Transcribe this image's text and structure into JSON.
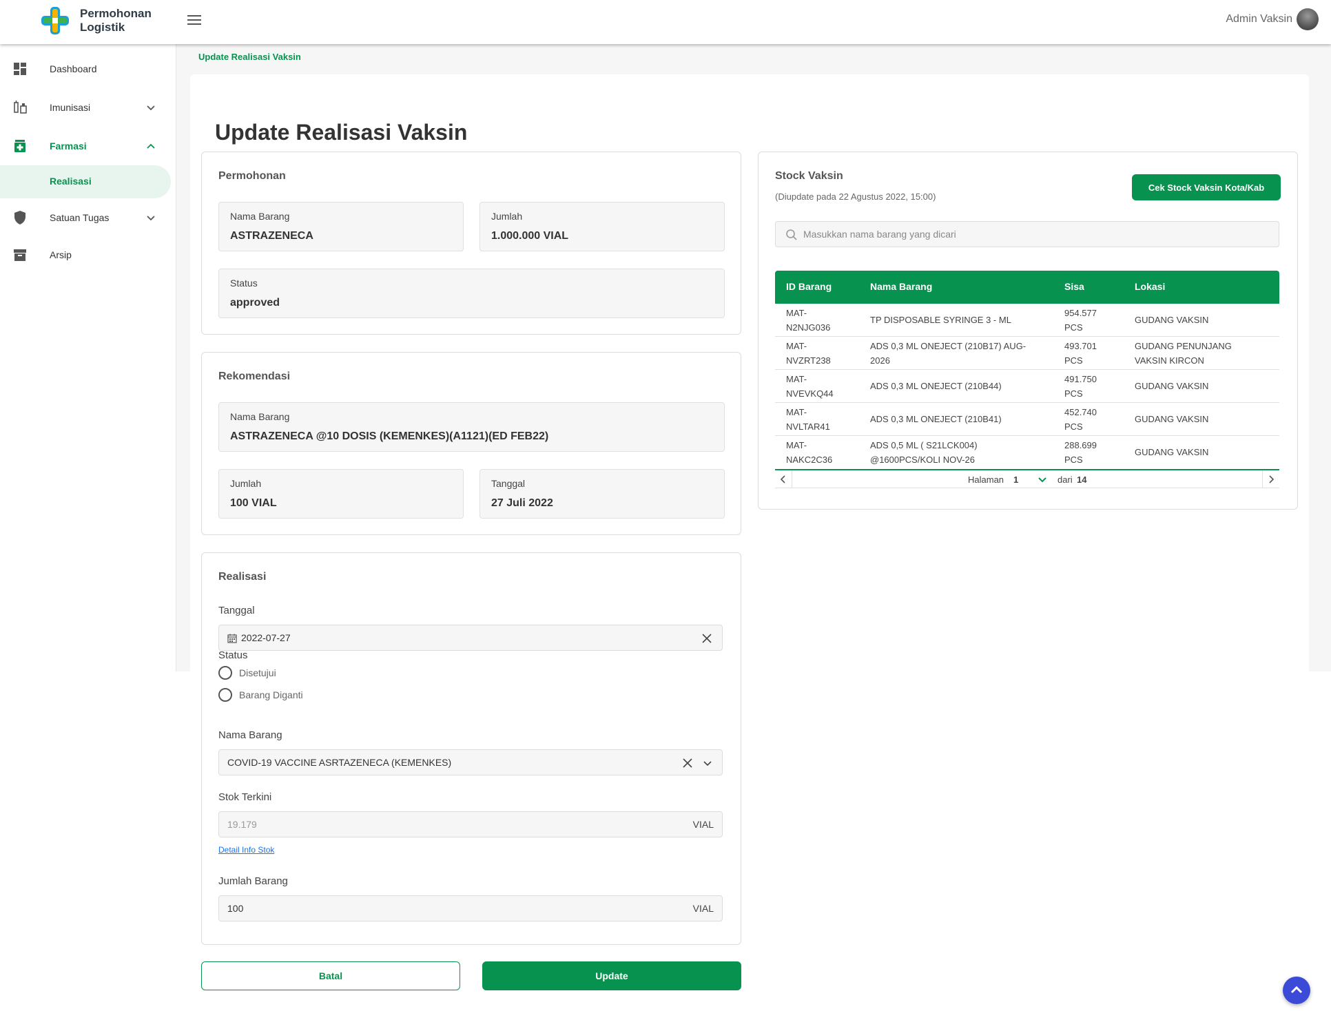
{
  "app": {
    "brand_line1": "Permohonan",
    "brand_line2": "Logistik",
    "accent": "#08924f"
  },
  "header": {
    "user_name": "Admin Vaksin"
  },
  "sidebar": {
    "items": [
      {
        "label": "Dashboard",
        "icon": "dashboard-icon"
      },
      {
        "label": "Imunisasi",
        "icon": "syringe-icon"
      },
      {
        "label": "Farmasi",
        "icon": "pharmacy-icon"
      },
      {
        "label": "Realisasi"
      },
      {
        "label": "Satuan Tugas",
        "icon": "shield-icon"
      },
      {
        "label": "Arsip",
        "icon": "archive-icon"
      }
    ]
  },
  "breadcrumb": "Update Realisasi Vaksin",
  "page_title": "Update Realisasi Vaksin",
  "permohonan": {
    "title": "Permohonan",
    "nama_barang_label": "Nama Barang",
    "nama_barang_value": "ASTRAZENECA",
    "jumlah_label": "Jumlah",
    "jumlah_value": "1.000.000 VIAL",
    "status_label": "Status",
    "status_value": "approved"
  },
  "rekomendasi": {
    "title": "Rekomendasi",
    "nama_barang_label": "Nama Barang",
    "nama_barang_value": "ASTRAZENECA @10 DOSIS (KEMENKES)(A1121)(ED FEB22)",
    "jumlah_label": "Jumlah",
    "jumlah_value": "100 VIAL",
    "tanggal_label": "Tanggal",
    "tanggal_value": "27 Juli 2022"
  },
  "realisasi": {
    "title": "Realisasi",
    "tanggal_label": "Tanggal",
    "tanggal_value": "2022-07-27",
    "status_label": "Status",
    "status_options": [
      "Disetujui",
      "Barang Diganti"
    ],
    "nama_barang_label": "Nama Barang",
    "nama_barang_value": "COVID-19 VACCINE ASRTAZENECA (KEMENKES)",
    "stok_label": "Stok Terkini",
    "stok_value": "19.179",
    "stok_unit": "VIAL",
    "detail_link": "Detail Info Stok",
    "jumlah_label": "Jumlah Barang",
    "jumlah_value": "100",
    "jumlah_unit": "VIAL"
  },
  "buttons": {
    "batal": "Batal",
    "update": "Update"
  },
  "stock": {
    "title": "Stock Vaksin",
    "updated": "(Diupdate pada 22 Agustus 2022, 15:00)",
    "cek_button": "Cek Stock Vaksin Kota/Kab",
    "search_placeholder": "Masukkan nama barang yang dicari",
    "columns": [
      "ID Barang",
      "Nama Barang",
      "Sisa",
      "Lokasi"
    ],
    "rows": [
      {
        "id1": "MAT-",
        "id2": "N2NJG036",
        "nama1": "TP DISPOSABLE SYRINGE 3 - ML",
        "nama2": "",
        "sisa1": "954.577",
        "sisa2": "PCS",
        "lokasi1": "GUDANG VAKSIN",
        "lokasi2": ""
      },
      {
        "id1": "MAT-",
        "id2": "NVZRT238",
        "nama1": "ADS 0,3 ML ONEJECT (210B17) AUG-",
        "nama2": "2026",
        "sisa1": "493.701",
        "sisa2": "PCS",
        "lokasi1": "GUDANG PENUNJANG",
        "lokasi2": "VAKSIN KIRCON"
      },
      {
        "id1": "MAT-",
        "id2": "NVEVKQ44",
        "nama1": "ADS 0,3 ML ONEJECT (210B44)",
        "nama2": "",
        "sisa1": "491.750",
        "sisa2": "PCS",
        "lokasi1": "GUDANG VAKSIN",
        "lokasi2": ""
      },
      {
        "id1": "MAT-",
        "id2": "NVLTAR41",
        "nama1": "ADS 0,3 ML ONEJECT (210B41)",
        "nama2": "",
        "sisa1": "452.740",
        "sisa2": "PCS",
        "lokasi1": "GUDANG VAKSIN",
        "lokasi2": ""
      },
      {
        "id1": "MAT-",
        "id2": "NAKC2C36",
        "nama1": "ADS 0,5 ML ( S21LCK004)",
        "nama2": "@1600PCS/KOLI NOV-26",
        "sisa1": "288.699",
        "sisa2": "PCS",
        "lokasi1": "GUDANG VAKSIN",
        "lokasi2": ""
      }
    ],
    "pager": {
      "halaman_label": "Halaman",
      "page": "1",
      "dari_label": "dari",
      "total": "14"
    }
  }
}
